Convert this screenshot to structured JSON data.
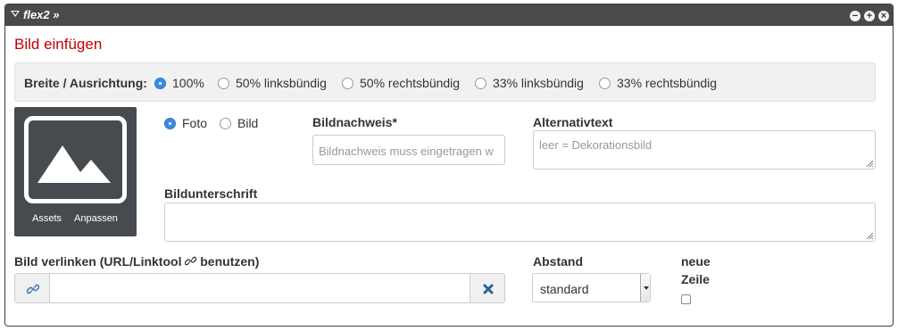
{
  "window": {
    "title": "flex2 »",
    "buttons": [
      "−",
      "+",
      "×"
    ]
  },
  "heading": "Bild einfügen",
  "width_options": {
    "label": "Breite / Ausrichtung:",
    "options": [
      {
        "label": "100%",
        "selected": true
      },
      {
        "label": "50% linksbündig",
        "selected": false
      },
      {
        "label": "50% rechtsbündig",
        "selected": false
      },
      {
        "label": "33% linksbündig",
        "selected": false
      },
      {
        "label": "33% rechtsbündig",
        "selected": false
      }
    ]
  },
  "image": {
    "assets_label": "Assets",
    "adjust_label": "Anpassen",
    "icon": "image-placeholder-icon"
  },
  "type": {
    "options": [
      {
        "label": "Foto",
        "selected": true
      },
      {
        "label": "Bild",
        "selected": false
      }
    ]
  },
  "credit": {
    "label": "Bildnachweis*",
    "placeholder": "Bildnachweis muss eingetragen w",
    "value": ""
  },
  "alt_text": {
    "label": "Alternativtext",
    "placeholder": "leer = Dekorationsbild",
    "value": ""
  },
  "caption": {
    "label": "Bildunterschrift",
    "value": ""
  },
  "link": {
    "label": "Bild verlinken (URL/Linktool",
    "label_suffix": "benutzen)",
    "value": "",
    "link_icon": "link-icon",
    "clear_icon": "clear-icon"
  },
  "spacing": {
    "label": "Abstand",
    "selected": "standard"
  },
  "new_line": {
    "label_line1": "neue",
    "label_line2": "Zeile",
    "checked": false
  },
  "colors": {
    "accent": "#3b8ae6",
    "heading": "#c00000",
    "titlebar": "#4a4a4a",
    "clear_icon": "#2a5f98"
  }
}
